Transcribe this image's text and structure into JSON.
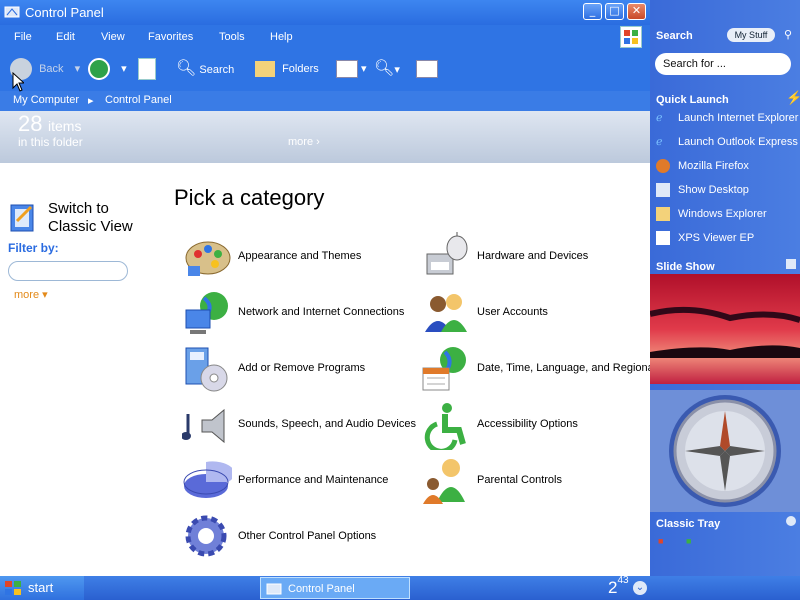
{
  "window": {
    "title": "Control Panel",
    "menu": [
      "File",
      "Edit",
      "View",
      "Favorites",
      "Tools",
      "Help"
    ],
    "toolbar": {
      "back": "Back",
      "search": "Search",
      "folders": "Folders"
    },
    "address": {
      "root": "My Computer",
      "current": "Control Panel"
    },
    "banner": {
      "count": "28",
      "items_label": "items",
      "folder_label": "in this folder",
      "more": "more"
    }
  },
  "left_pane": {
    "switch_view": "Switch to Classic View",
    "filter_label": "Filter by:",
    "filter_value": "",
    "more": "more"
  },
  "main": {
    "heading": "Pick a category",
    "categories": [
      {
        "label": "Appearance and Themes",
        "icon": "appearance-icon"
      },
      {
        "label": "Hardware and Devices",
        "icon": "hardware-icon"
      },
      {
        "label": "Network and Internet Connections",
        "icon": "network-icon"
      },
      {
        "label": "User Accounts",
        "icon": "user-accounts-icon"
      },
      {
        "label": "Add or Remove Programs",
        "icon": "programs-icon"
      },
      {
        "label": "Date, Time, Language, and Regional",
        "icon": "datetime-icon"
      },
      {
        "label": "Sounds, Speech, and Audio Devices",
        "icon": "sounds-icon"
      },
      {
        "label": "Accessibility Options",
        "icon": "accessibility-icon"
      },
      {
        "label": "Performance and Maintenance",
        "icon": "performance-icon"
      },
      {
        "label": "Parental Controls",
        "icon": "parental-icon"
      },
      {
        "label": "Other Control Panel Options",
        "icon": "other-options-icon"
      }
    ]
  },
  "sidebar": {
    "search_header": "Search",
    "mystuff": "My Stuff",
    "search_placeholder": "Search for ...",
    "quick_launch_header": "Quick Launch",
    "quick_launch": [
      {
        "label": "Launch Internet Explorer",
        "icon": "ie-icon"
      },
      {
        "label": "Launch Outlook Express",
        "icon": "outlook-icon"
      },
      {
        "label": "Mozilla Firefox",
        "icon": "firefox-icon"
      },
      {
        "label": "Show Desktop",
        "icon": "desktop-icon"
      },
      {
        "label": "Windows Explorer",
        "icon": "explorer-icon"
      },
      {
        "label": "XPS Viewer EP",
        "icon": "xps-icon"
      }
    ],
    "slideshow_header": "Slide Show",
    "classic_tray_header": "Classic Tray"
  },
  "taskbar": {
    "start": "start",
    "active_task": "Control Panel",
    "clock_hour": "2",
    "clock_min": "43"
  },
  "colors": {
    "accent": "#2f74e4",
    "link": "#2a6be0",
    "more": "#e38a1a"
  }
}
